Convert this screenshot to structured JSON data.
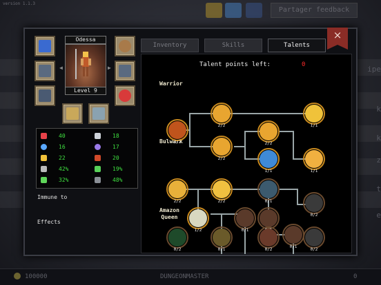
{
  "background": {
    "version": "version 1.1.3",
    "feedback_label": "Partager feedback",
    "bottom_left": "100000",
    "bottom_center": "DUNGEONMASTER",
    "bottom_right": "0",
    "side_texts": [
      "ipe",
      "k",
      "k",
      "z",
      "t",
      "e"
    ]
  },
  "hero": {
    "name": "Odessa",
    "level": "Level 9",
    "equipment": [
      "quiver-icon",
      "ring-icon",
      "chest-armor-icon",
      "bracer-icon",
      "boots-icon",
      "red-gem-icon",
      "spear-icon",
      "shield-icon"
    ]
  },
  "stats": [
    {
      "icon": "heart-icon",
      "value": "40",
      "color": "#e8424a"
    },
    {
      "icon": "sword-icon",
      "value": "18",
      "color": "#cfd3da"
    },
    {
      "icon": "blue-orb-icon",
      "value": "16",
      "color": "#5aa8ff"
    },
    {
      "icon": "swirl-icon",
      "value": "17",
      "color": "#9a7ae8"
    },
    {
      "icon": "lightning-icon",
      "value": "22",
      "color": "#f2c23a"
    },
    {
      "icon": "boot-speed-icon",
      "value": "20",
      "color": "#d14a2a"
    },
    {
      "icon": "gear-icon",
      "value": "42%",
      "color": "#bbbbbb"
    },
    {
      "icon": "green-leaf-icon",
      "value": "19%",
      "color": "#58d058"
    },
    {
      "icon": "green-shield-icon",
      "value": "32%",
      "color": "#5fd65a"
    },
    {
      "icon": "grey-shield-icon",
      "value": "48%",
      "color": "#8a8f96"
    }
  ],
  "labels": {
    "immune": "Immune to",
    "effects": "Effects"
  },
  "tabs": [
    {
      "label": "Inventory",
      "active": false
    },
    {
      "label": "Skills",
      "active": false
    },
    {
      "label": "Talents",
      "active": true
    }
  ],
  "close_label": "×",
  "talents": {
    "points_label": "Talent points left:",
    "points_value": "0",
    "trees": [
      "Warrior",
      "Bulwark",
      "Amazon\nQueen"
    ],
    "nodes": [
      {
        "id": "w1",
        "count": "2/2",
        "color": "#c0541c"
      },
      {
        "id": "w2",
        "count": "2/2",
        "color": "#e8a530"
      },
      {
        "id": "w3",
        "count": "2/2",
        "color": "#e8a530"
      },
      {
        "id": "w4",
        "count": "2/2",
        "color": "#e8a530"
      },
      {
        "id": "w5",
        "count": "1/1",
        "color": "#3f8ad6"
      },
      {
        "id": "w6",
        "count": "1/1",
        "color": "#f0c23a"
      },
      {
        "id": "w7",
        "count": "1/1",
        "color": "#f0b040"
      },
      {
        "id": "b1",
        "count": "2/2",
        "color": "#e8b03a"
      },
      {
        "id": "b2",
        "count": "2/2",
        "color": "#f0c040"
      },
      {
        "id": "b3",
        "count": "0/1",
        "color": "#3c5a6e"
      },
      {
        "id": "b4",
        "count": "0/2",
        "color": "#3a3a3a"
      },
      {
        "id": "b5",
        "count": "1/2",
        "color": "#d8d8c0"
      },
      {
        "id": "b6",
        "count": "0/1",
        "color": "#5a3a2a"
      },
      {
        "id": "b7",
        "count": "0/1",
        "color": "#5a3a2a"
      },
      {
        "id": "a1",
        "count": "0/1",
        "color": "#5a3a2a"
      },
      {
        "id": "a2",
        "count": "0/2",
        "color": "#1e4a2a"
      },
      {
        "id": "a3",
        "count": "0/1",
        "color": "#6a5a2a"
      },
      {
        "id": "a4",
        "count": "0/2",
        "color": "#6a3a2a"
      },
      {
        "id": "a5",
        "count": "0/2",
        "color": "#3a3a3a"
      }
    ]
  }
}
